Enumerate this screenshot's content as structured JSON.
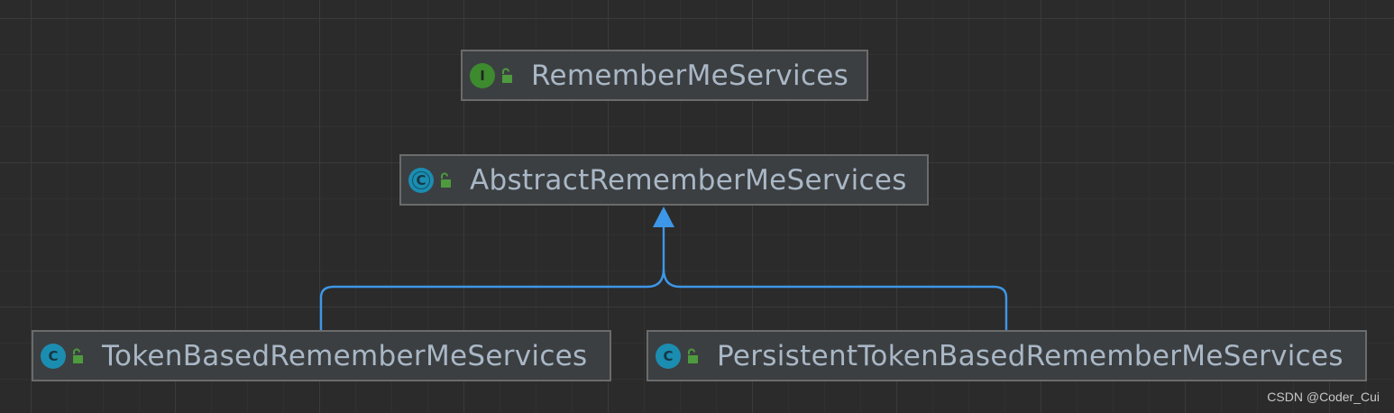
{
  "diagram": {
    "background_color": "#2b2b2b",
    "edge_color": "#3d97e8",
    "nodes": [
      {
        "id": "remember-me-services",
        "kind": "interface",
        "kind_letter": "I",
        "visibility_icon": "lock-open-icon",
        "label": "RememberMeServices"
      },
      {
        "id": "abstract-remember-me-services",
        "kind": "abstract-class",
        "kind_letter": "C",
        "visibility_icon": "lock-open-icon",
        "label": "AbstractRememberMeServices"
      },
      {
        "id": "token-based-remember-me-services",
        "kind": "class",
        "kind_letter": "C",
        "visibility_icon": "lock-open-icon",
        "label": "TokenBasedRememberMeServices"
      },
      {
        "id": "persistent-token-based-remember-me-services",
        "kind": "class",
        "kind_letter": "C",
        "visibility_icon": "lock-open-icon",
        "label": "PersistentTokenBasedRememberMeServices"
      }
    ],
    "edges": [
      {
        "from": "token-based-remember-me-services",
        "to": "abstract-remember-me-services",
        "type": "extends"
      },
      {
        "from": "persistent-token-based-remember-me-services",
        "to": "abstract-remember-me-services",
        "type": "extends"
      }
    ]
  },
  "watermark": "CSDN @Coder_Cui"
}
